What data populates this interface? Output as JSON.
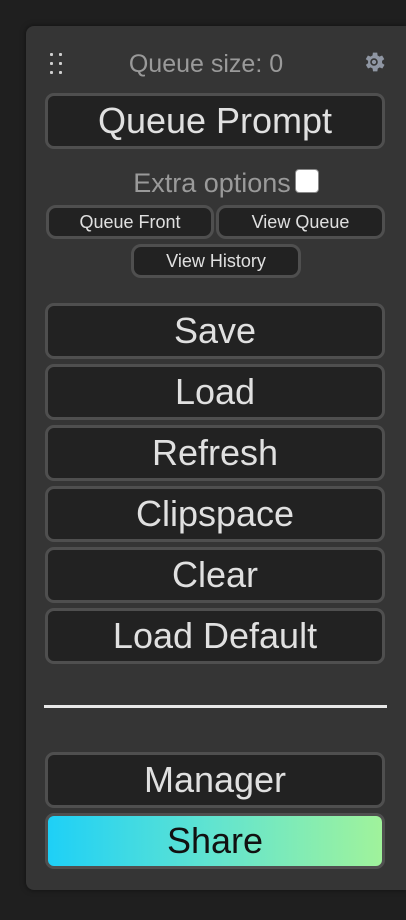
{
  "menu": {
    "queue_size_label": "Queue size: 0",
    "queue_prompt_label": "Queue Prompt",
    "extra_options_label": "Extra options",
    "extra_options_checked": false,
    "queue_front_label": "Queue Front",
    "view_queue_label": "View Queue",
    "view_history_label": "View History",
    "buttons": {
      "save": "Save",
      "load": "Load",
      "refresh": "Refresh",
      "clipspace": "Clipspace",
      "clear": "Clear",
      "load_default": "Load Default",
      "manager": "Manager",
      "share": "Share"
    },
    "icons": {
      "drag": "drag-handle-icon",
      "settings": "gear-icon"
    },
    "colors": {
      "panel_bg": "#353535",
      "button_bg": "#222222",
      "button_border": "#4f4f4f",
      "text": "#e0e0e0",
      "share_gradient_start": "#1ed0f7",
      "share_gradient_end": "#a0f39b"
    }
  }
}
